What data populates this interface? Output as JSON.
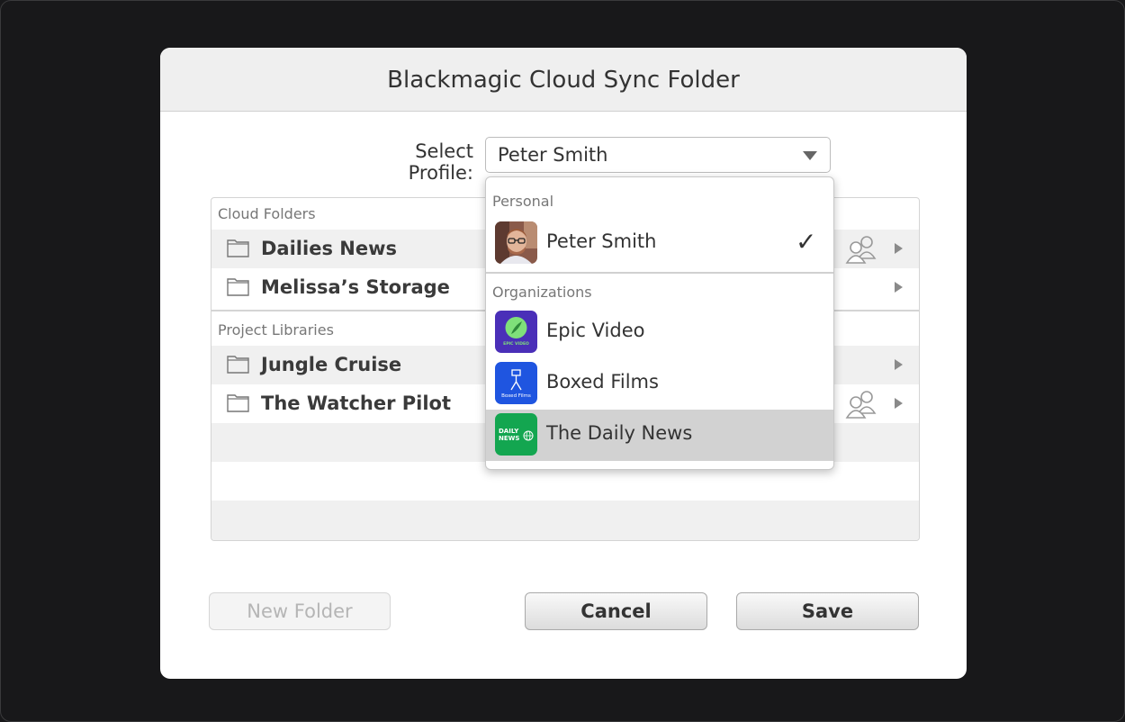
{
  "dialog": {
    "title": "Blackmagic Cloud Sync Folder"
  },
  "profile": {
    "label": "Select Profile:",
    "selected": "Peter Smith"
  },
  "list": {
    "cloud_folders_label": "Cloud Folders",
    "cloud_folders": [
      {
        "name": "Dailies News",
        "shared": true
      },
      {
        "name": "Melissa’s Storage",
        "shared": false
      }
    ],
    "project_libraries_label": "Project Libraries",
    "project_libraries": [
      {
        "name": "Jungle Cruise",
        "shared": false
      },
      {
        "name": "The Watcher Pilot",
        "shared": true
      }
    ]
  },
  "dropdown": {
    "personal_label": "Personal",
    "personal": [
      {
        "name": "Peter Smith",
        "checked": true,
        "icon": "user-photo-avatar"
      }
    ],
    "organizations_label": "Organizations",
    "organizations": [
      {
        "name": "Epic Video",
        "icon": "epic-video-logo",
        "color": "#4a2fb8",
        "logo_text": "EPIC VIDEO"
      },
      {
        "name": "Boxed Films",
        "icon": "boxed-films-logo",
        "color": "#1f55e0",
        "logo_text": "Boxed Films"
      },
      {
        "name": "The Daily News",
        "icon": "daily-news-logo",
        "color": "#13a650",
        "logo_text": "DAILY NEWS",
        "highlighted": true
      }
    ]
  },
  "buttons": {
    "new_folder": "New Folder",
    "cancel": "Cancel",
    "save": "Save"
  }
}
